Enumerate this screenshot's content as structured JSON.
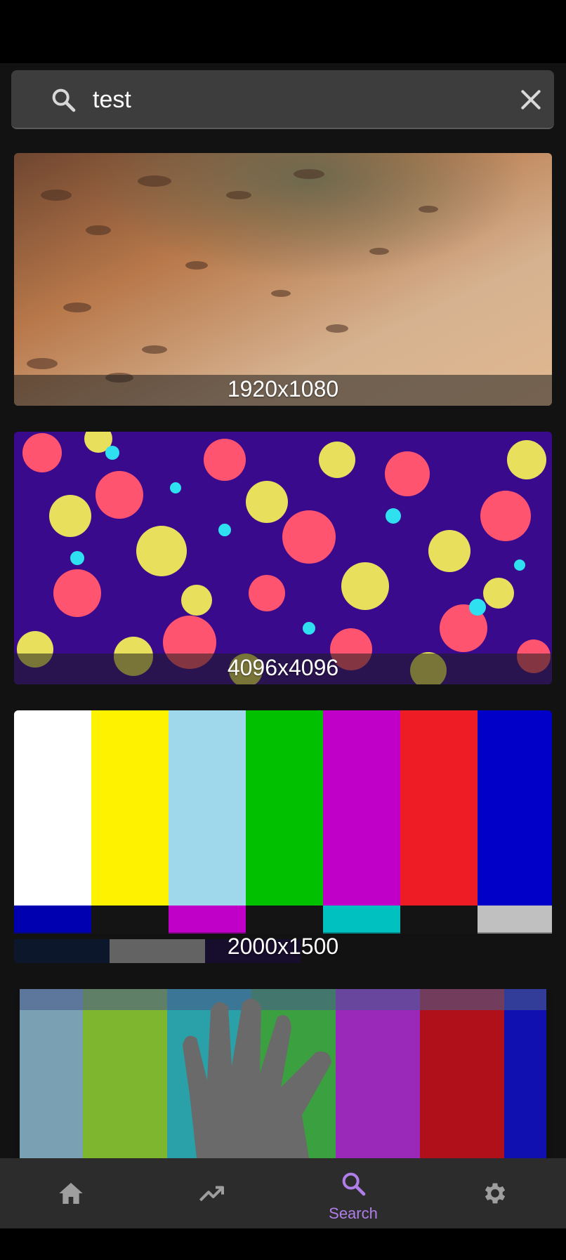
{
  "search": {
    "query": "test",
    "search_icon": "search-icon",
    "clear_icon": "close-icon"
  },
  "results": [
    {
      "resolution": "1920x1080",
      "thumbnail": "warm-pixelated-abstract"
    },
    {
      "resolution": "4096x4096",
      "thumbnail": "colorful-noise-blobs"
    },
    {
      "resolution": "2000x1500",
      "thumbnail": "tv-color-bars"
    },
    {
      "resolution": "",
      "thumbnail": "glitched-color-bars-with-hand"
    }
  ],
  "bottom_nav": {
    "items": [
      {
        "icon": "home-icon",
        "label": ""
      },
      {
        "icon": "trending-icon",
        "label": ""
      },
      {
        "icon": "search-icon",
        "label": "Search",
        "active": true
      },
      {
        "icon": "gear-icon",
        "label": ""
      }
    ]
  },
  "colors": {
    "background": "#121212",
    "search_bar": "#3d3d3d",
    "nav_background": "#2c2c2c",
    "accent": "#b07ee8",
    "nav_inactive": "#9e9e9e"
  }
}
